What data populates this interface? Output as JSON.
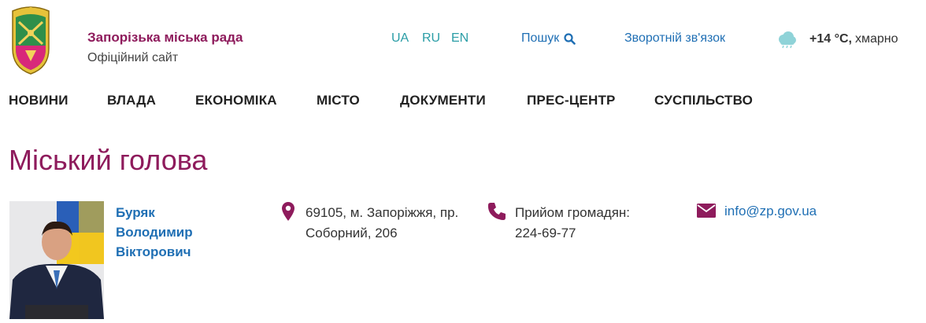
{
  "header": {
    "title": "Запорізька міська рада",
    "subtitle": "Офіційний сайт",
    "languages": [
      "UA",
      "RU",
      "EN"
    ],
    "search_label": "Пошук",
    "feedback_label": "Зворотній зв'язок",
    "weather": {
      "temp": "+14 °C,",
      "condition": "хмарно",
      "icon": "cloud-icon"
    }
  },
  "nav": {
    "items": [
      "НОВИНИ",
      "ВЛАДА",
      "ЕКОНОМІКА",
      "МІСТО",
      "ДОКУМЕНТИ",
      "ПРЕС-ЦЕНТР",
      "СУСПІЛЬСТВО"
    ]
  },
  "main": {
    "title": "Міський голова",
    "person": {
      "name_lines": [
        "Буряк",
        "Володимир",
        "Вікторович"
      ]
    },
    "address": {
      "lines": [
        "69105, м. Запоріжжя, пр.",
        "Соборний, 206"
      ],
      "icon": "map-pin-icon"
    },
    "phone": {
      "lines": [
        "Прийом громадян:",
        "224-69-77"
      ],
      "icon": "phone-icon"
    },
    "email": {
      "value": "info@zp.gov.ua",
      "icon": "envelope-icon"
    }
  },
  "colors": {
    "brand": "#8e1b5c",
    "link": "#1f6fb4",
    "lang": "#2a9da6"
  }
}
